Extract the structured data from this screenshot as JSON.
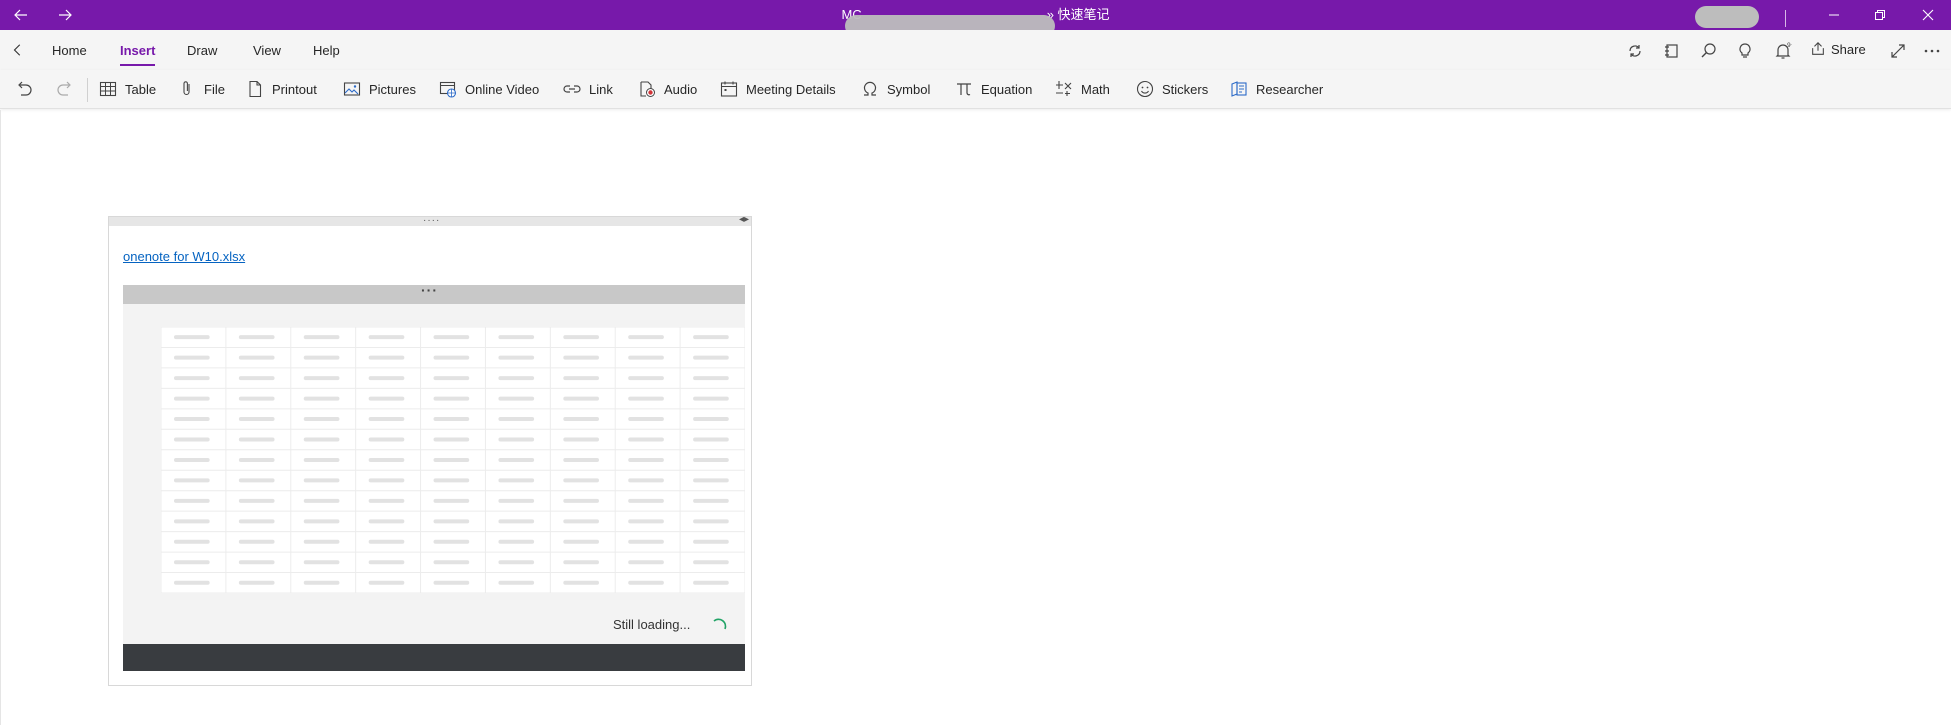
{
  "window": {
    "title_visible": "MC",
    "title_suffix": "» 快速笔记"
  },
  "menu": {
    "tabs": [
      {
        "label": "Home"
      },
      {
        "label": "Insert",
        "active": true
      },
      {
        "label": "Draw"
      },
      {
        "label": "View"
      },
      {
        "label": "Help"
      }
    ],
    "share_label": "Share"
  },
  "toolbar": {
    "items": [
      {
        "label": "Table",
        "icon": "table-icon"
      },
      {
        "label": "File",
        "icon": "paperclip-icon"
      },
      {
        "label": "Printout",
        "icon": "printout-icon"
      },
      {
        "label": "Pictures",
        "icon": "picture-icon"
      },
      {
        "label": "Online Video",
        "icon": "online-video-icon"
      },
      {
        "label": "Link",
        "icon": "link-icon"
      },
      {
        "label": "Audio",
        "icon": "audio-icon"
      },
      {
        "label": "Meeting Details",
        "icon": "calendar-icon"
      },
      {
        "label": "Symbol",
        "icon": "omega-icon"
      },
      {
        "label": "Equation",
        "icon": "pi-icon"
      },
      {
        "label": "Math",
        "icon": "math-icon"
      },
      {
        "label": "Stickers",
        "icon": "smiley-icon"
      },
      {
        "label": "Researcher",
        "icon": "researcher-icon"
      }
    ]
  },
  "note": {
    "file_link": "onenote for W10.xlsx",
    "loading_text": "Still loading..."
  },
  "colors": {
    "accent": "#7719aa",
    "link": "#0563c1"
  }
}
